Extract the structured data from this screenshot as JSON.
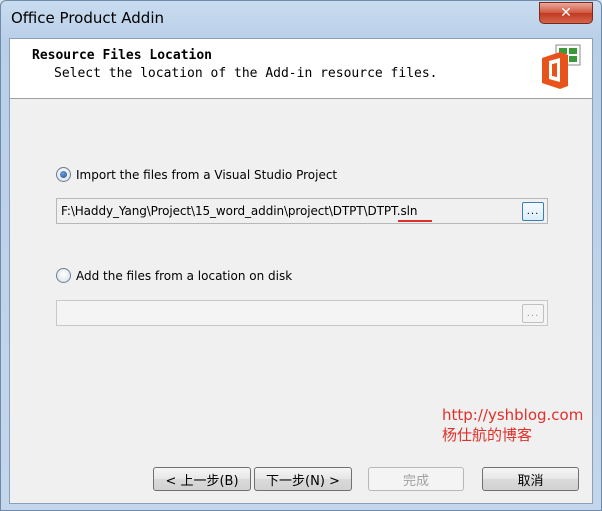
{
  "window": {
    "title": "Office Product Addin",
    "close_label": "✕"
  },
  "header": {
    "title": "Resource Files Location",
    "subtitle": "Select the location of the Add-in resource files."
  },
  "options": {
    "import": {
      "label": "Import the files from a Visual Studio Project",
      "selected": true,
      "path_value": "F:\\Haddy_Yang\\Project\\15_word_addin\\project\\DTPT\\DTPT.sln",
      "browse_label": "..."
    },
    "disk": {
      "label": "Add the files from a location on disk",
      "selected": false,
      "path_value": "",
      "browse_label": "..."
    }
  },
  "watermark": {
    "url": "http://yshblog.com",
    "name": "杨仕航的博客"
  },
  "buttons": {
    "back": "< 上一步(B)",
    "next": "下一步(N) >",
    "finish": "完成",
    "cancel": "取消"
  },
  "colors": {
    "office_orange": "#e8531c",
    "annotation_red": "#e0302a",
    "accent_blue": "#3c7fb1"
  }
}
